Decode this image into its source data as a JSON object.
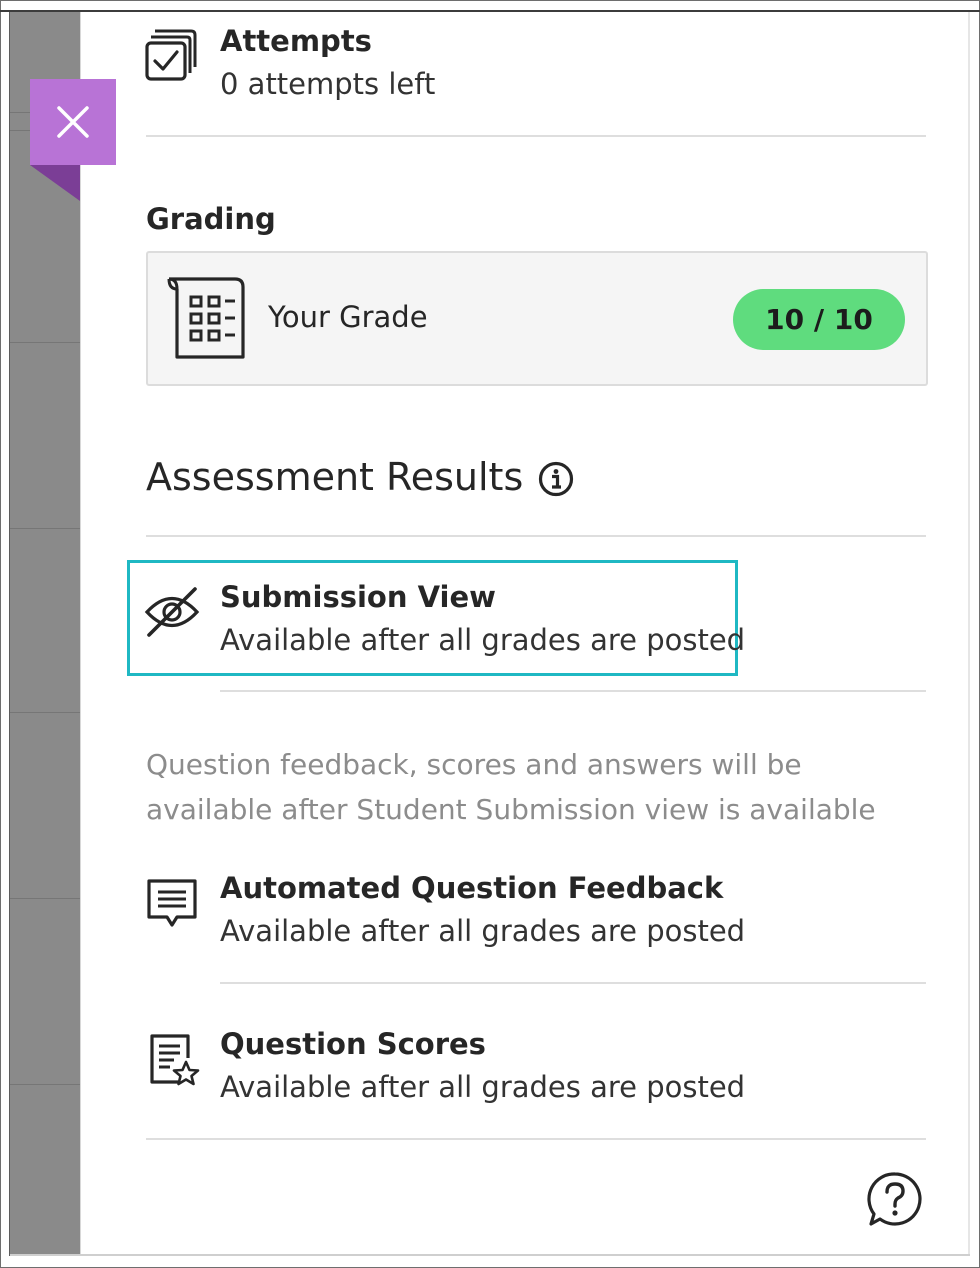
{
  "close_button": {
    "icon": "close-icon"
  },
  "attempts": {
    "title": "Attempts",
    "value": "0 attempts left",
    "icon": "checkbox-stack-icon"
  },
  "grading": {
    "heading": "Grading",
    "your_grade_label": "Your Grade",
    "grade_value": "10 / 10",
    "icon": "gradebook-icon",
    "pill_color": "#5fdc7e"
  },
  "assessment_results": {
    "heading": "Assessment Results",
    "info_icon": "info-icon",
    "submission_view": {
      "title": "Submission View",
      "status": "Available after all grades are posted",
      "icon": "eye-off-icon",
      "highlight_color": "#1fb8c3"
    },
    "note_line1": "Question feedback, scores and answers will be",
    "note_line2": "available after Student Submission view is available",
    "feedback": {
      "title": "Automated Question Feedback",
      "status": "Available after all grades are posted",
      "icon": "feedback-icon"
    },
    "scores": {
      "title": "Question Scores",
      "status": "Available after all grades are posted",
      "icon": "scores-icon"
    }
  },
  "help": {
    "icon": "help-icon"
  },
  "colors": {
    "accent_purple": "#b873d6",
    "accent_purple_dark": "#7b3e96"
  }
}
